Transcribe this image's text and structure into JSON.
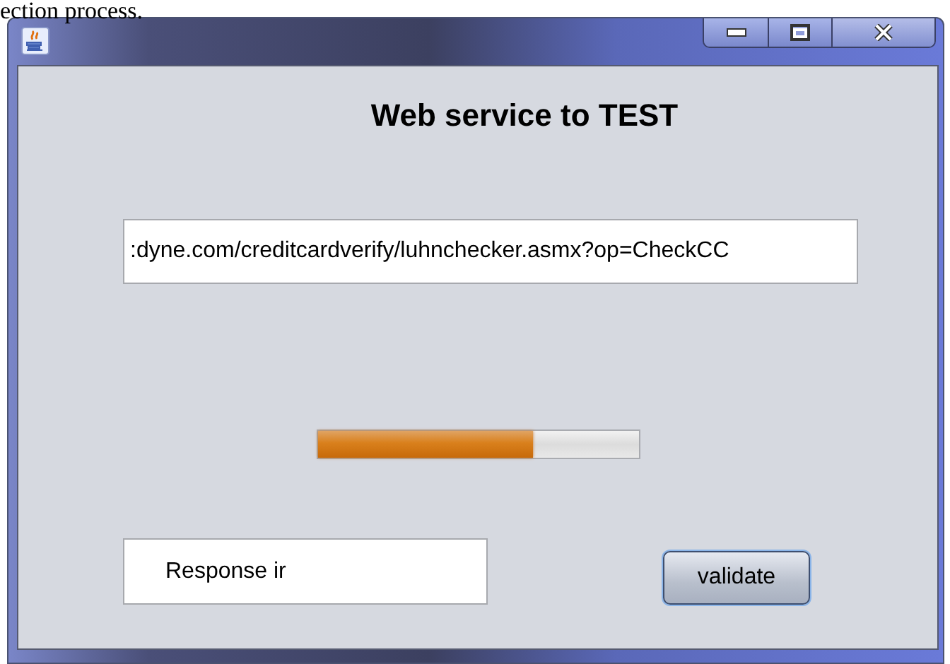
{
  "document_text": "ection process.",
  "heading": "Web service to TEST",
  "url_field": {
    "value": ":dyne.com/creditcardverify/luhnchecker.asmx?op=CheckCC"
  },
  "progress": {
    "level": 0.67
  },
  "response_field": {
    "value": "Response ir"
  },
  "buttons": [
    {
      "label": "validate",
      "focused": true
    }
  ]
}
